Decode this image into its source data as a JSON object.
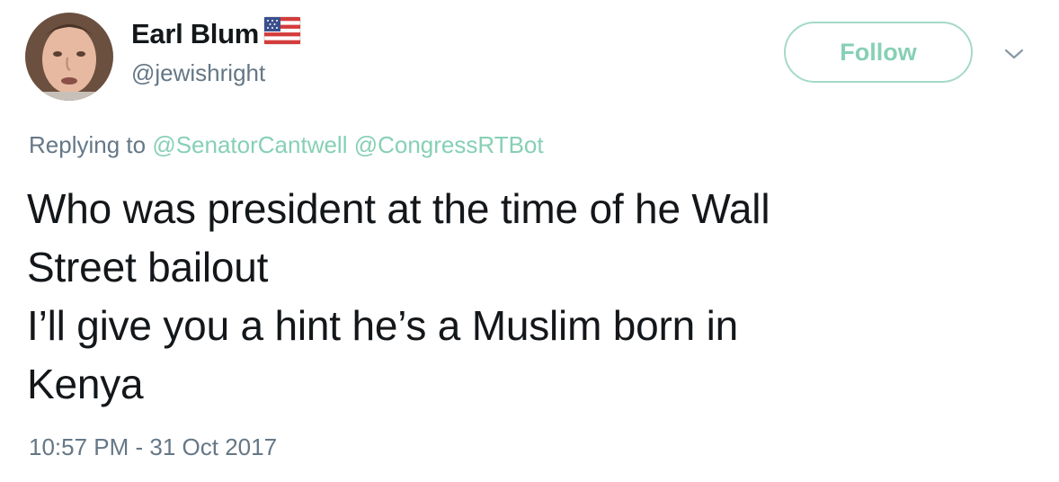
{
  "user": {
    "display_name": "Earl Blum",
    "handle": "@jewishright",
    "badge_icon": "us-flag-icon"
  },
  "actions": {
    "follow_label": "Follow",
    "more_icon": "chevron-down-icon"
  },
  "reply_context": {
    "prefix": "Replying to",
    "mentions": [
      "@SenatorCantwell",
      "@CongressRTBot"
    ]
  },
  "tweet": {
    "lines": [
      "Who was president at the time of he Wall",
      "Street bailout",
      "I’ll give you a hint he’s a Muslim born in",
      "Kenya"
    ],
    "timestamp": "10:57 PM - 31 Oct 2017"
  },
  "colors": {
    "text": "#14171a",
    "secondary": "#657786",
    "accent": "#86d0b5",
    "follow_border": "#a4dac6"
  }
}
